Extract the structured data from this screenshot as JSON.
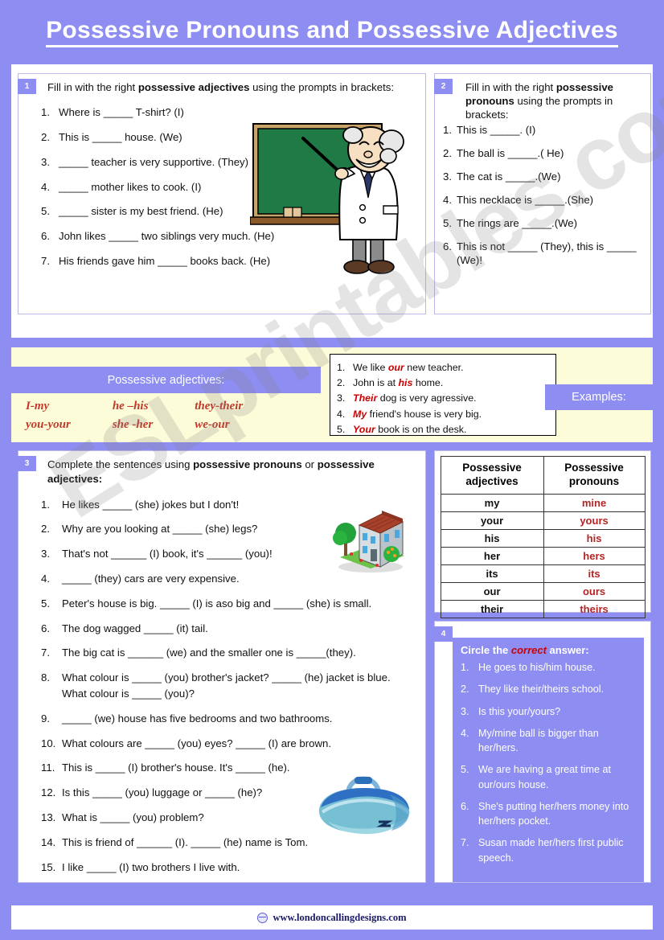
{
  "title": "Possessive Pronouns and Possessive Adjectives",
  "exercise1": {
    "badge": "1",
    "instruction_pre": "Fill in with the right ",
    "instruction_bold": "possessive adjectives",
    "instruction_post": " using the prompts in brackets:",
    "items": [
      {
        "n": "1.",
        "text": "Where is _____ T-shirt? (I)"
      },
      {
        "n": "2.",
        "text": "This is _____ house. (We)"
      },
      {
        "n": "3.",
        "text": " _____ teacher is very supportive. (They)"
      },
      {
        "n": "4.",
        "text": " _____ mother likes to cook.  (I)"
      },
      {
        "n": "5.",
        "text": " _____ sister is my best friend. (He)"
      },
      {
        "n": "6.",
        "text": "John likes _____ two siblings very much. (He)"
      },
      {
        "n": "7.",
        "text": "His friends gave him _____ books back. (He)"
      }
    ],
    "illustration": "teacher-at-blackboard-image"
  },
  "exercise2": {
    "badge": "2",
    "instruction_pre": "Fill in with the right ",
    "instruction_bold": "possessive pronouns",
    "instruction_post": " using the prompts in brackets:",
    "items": [
      {
        "n": "1.",
        "text": "This is _____. (I)"
      },
      {
        "n": "2.",
        "text": "The ball is _____.( He)"
      },
      {
        "n": "3.",
        "text": "The cat is _____.(We)"
      },
      {
        "n": "4.",
        "text": "This necklace is _____.(She)"
      },
      {
        "n": "5.",
        "text": "The rings are _____.(We)"
      },
      {
        "n": "6.",
        "text": "This is not _____ (They), this is _____ (We)!"
      }
    ]
  },
  "reference_band": {
    "adjectives_header": "Possessive adjectives:",
    "pairs_columns": [
      [
        "I-my",
        "you-your"
      ],
      [
        "he –his",
        "she -her"
      ],
      [
        "they-their",
        "we-our"
      ]
    ],
    "examples_label": "Examples:",
    "examples": [
      {
        "n": "1.",
        "pre": "We like ",
        "hl": "our",
        "post": " new teacher."
      },
      {
        "n": "2.",
        "pre": "John is at ",
        "hl": "his",
        "post": " home."
      },
      {
        "n": "3.",
        "pre": "",
        "hl": "Their",
        "post": " dog is very agressive."
      },
      {
        "n": "4.",
        "pre": "",
        "hl": "My",
        "post": " friend's house is very big."
      },
      {
        "n": "5.",
        "pre": "",
        "hl": "Your",
        "post": " book is on the desk."
      }
    ]
  },
  "exercise3": {
    "badge": "3",
    "instruction_pre": "Complete the sentences using ",
    "instruction_bold1": "possessive pronouns",
    "instruction_mid": " or ",
    "instruction_bold2": "possessive adjectives:",
    "items": [
      {
        "n": "1.",
        "text": "He likes _____ (she) jokes but I don't!"
      },
      {
        "n": "2.",
        "text": "Why are you looking at _____ (she) legs?"
      },
      {
        "n": "3.",
        "text": "That's not ______ (I) book, it's ______ (you)!"
      },
      {
        "n": "4.",
        "text": "_____ (they) cars are very expensive."
      },
      {
        "n": "5.",
        "text": "Peter's house is big. _____ (I) is aso big and _____ (she) is small."
      },
      {
        "n": "6.",
        "text": "The dog wagged _____ (it) tail."
      },
      {
        "n": "7.",
        "text": "The big cat is ______ (we) and the smaller one is _____(they)."
      },
      {
        "n": "8.",
        "text": "What colour is _____ (you) brother's jacket? _____ (he) jacket is blue. What colour is _____ (you)?"
      },
      {
        "n": "9.",
        "text": " _____ (we) house has five bedrooms and two bathrooms."
      },
      {
        "n": "10.",
        "text": "What colours are _____ (you) eyes? _____ (I) are brown."
      },
      {
        "n": "11.",
        "text": "This is _____ (I) brother's house. It's _____ (he)."
      },
      {
        "n": "12.",
        "text": "Is this _____ (you) luggage or _____ (he)?"
      },
      {
        "n": "13.",
        "text": "What is _____ (you) problem?"
      },
      {
        "n": "14.",
        "text": "This is friend of ______ (I). _____ (he) name is Tom."
      },
      {
        "n": "15.",
        "text": "I like _____ (I) two brothers I live with."
      }
    ],
    "illustration_house": "house-image",
    "illustration_bag": "blue-duffel-bag-image"
  },
  "reference_table": {
    "headers": [
      "Possessive adjectives",
      "Possessive pronouns"
    ],
    "rows": [
      [
        "my",
        "mine"
      ],
      [
        "your",
        "yours"
      ],
      [
        "his",
        "his"
      ],
      [
        "her",
        "hers"
      ],
      [
        "its",
        "its"
      ],
      [
        "our",
        "ours"
      ],
      [
        "their",
        "theirs"
      ]
    ]
  },
  "exercise4": {
    "badge": "4",
    "title_pre": "Circle the ",
    "title_hl": "correct",
    "title_post": " answer:",
    "items": [
      {
        "n": "1.",
        "text": "He goes to his/him house."
      },
      {
        "n": "2.",
        "text": "They like their/theirs  school."
      },
      {
        "n": "3.",
        "text": "Is this your/yours?"
      },
      {
        "n": "4.",
        "text": "My/mine ball is bigger than her/hers."
      },
      {
        "n": "5.",
        "text": "We are having a great time at our/ours house."
      },
      {
        "n": "6.",
        "text": "She's putting her/hers money into her/hers pocket."
      },
      {
        "n": "7.",
        "text": "Susan made her/hers first public speech."
      }
    ]
  },
  "watermark": "ESLprintables.com",
  "footer": {
    "url": "www.londoncallingdesigns.com"
  },
  "colors": {
    "page_background": "#8d8df2",
    "accent_purple": "#8d8df2",
    "cream": "#fdfcd9",
    "red_text": "#c0392b",
    "table_pronoun_red": "#b52424"
  }
}
